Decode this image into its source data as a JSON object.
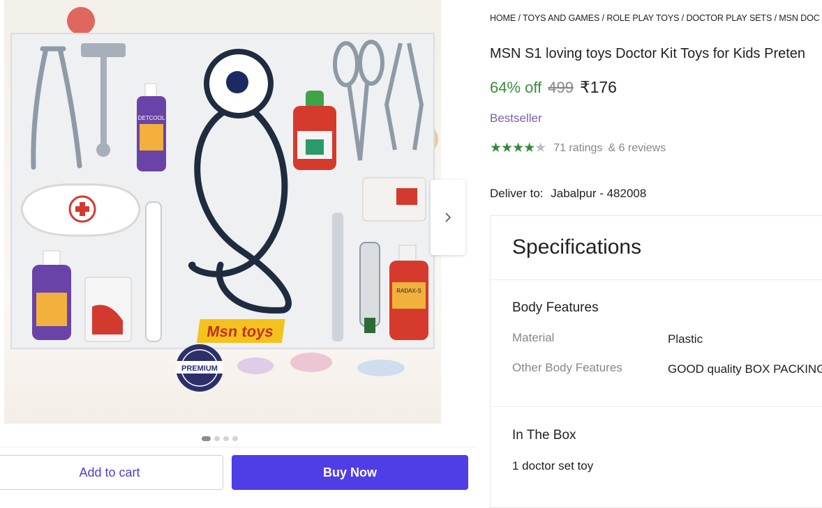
{
  "breadcrumb": {
    "items": [
      "HOME",
      "TOYS AND GAMES",
      "ROLE PLAY TOYS",
      "DOCTOR PLAY SETS",
      "MSN DOC"
    ],
    "separator": " / "
  },
  "product": {
    "title": "MSN S1 loving toys Doctor Kit Toys for Kids Preten",
    "discount": "64% off",
    "mrp": "499",
    "price": "₹176",
    "badge": "Bestseller",
    "rating_stars": 4.5,
    "ratings": "71 ratings",
    "reviews": "& 6 reviews"
  },
  "image": {
    "brand_text": "Msn toys",
    "seal_text": "PREMIUM",
    "bottle_label": "DETCOOL",
    "red_bottle_label": "RADAX-S"
  },
  "carousel": {
    "total_dots": 4,
    "active_dot": 0
  },
  "delivery": {
    "label": "Deliver to:",
    "location": "Jabalpur - 482008"
  },
  "specifications": {
    "title": "Specifications",
    "groups": [
      {
        "title": "Body Features",
        "rows": [
          {
            "key": "Material",
            "value": "Plastic"
          },
          {
            "key": "Other Body Features",
            "value": "GOOD quality BOX PACKING"
          }
        ]
      },
      {
        "title": "In The Box",
        "rows": [
          {
            "key": "",
            "value": "1 doctor set toy"
          }
        ]
      }
    ]
  },
  "actions": {
    "add_to_cart": "Add to cart",
    "buy_now": "Buy Now"
  },
  "colors": {
    "accent": "#4f3de6",
    "discount": "#388e3c",
    "bestseller": "#7b5fb0",
    "star": "#2f8a3a"
  }
}
